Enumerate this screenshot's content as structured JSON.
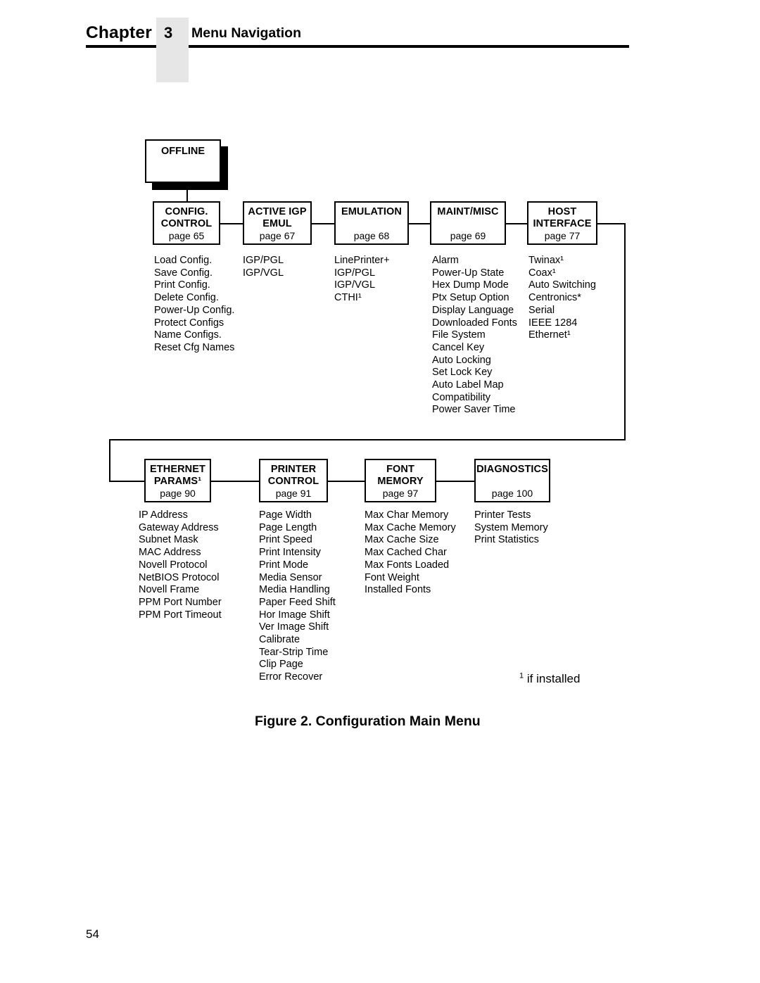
{
  "header": {
    "chapter_word": "Chapter",
    "chapter_number": "3",
    "chapter_title": "Menu Navigation"
  },
  "diagram": {
    "root": {
      "title": "OFFLINE"
    },
    "row1": [
      {
        "id": "config-control",
        "title_line1": "CONFIG.",
        "title_line2": "CONTROL",
        "page": "page 65",
        "items": [
          "Load Config.",
          "Save Config.",
          "Print Config.",
          "Delete Config.",
          "Power-Up Config.",
          "Protect Configs",
          "Name Configs.",
          "Reset Cfg Names"
        ]
      },
      {
        "id": "active-igp-emul",
        "title_line1": "ACTIVE IGP",
        "title_line2": "EMUL",
        "page": "page 67",
        "items": [
          "IGP/PGL",
          "IGP/VGL"
        ]
      },
      {
        "id": "emulation",
        "title_line1": "EMULATION",
        "title_line2": "",
        "page": "page 68",
        "items": [
          "LinePrinter+",
          "IGP/PGL",
          "IGP/VGL",
          "CTHI¹"
        ]
      },
      {
        "id": "maint-misc",
        "title_line1": "MAINT/MISC",
        "title_line2": "",
        "page": "page 69",
        "items": [
          "Alarm",
          "Power-Up State",
          "Hex Dump Mode",
          "Ptx Setup Option",
          "Display Language",
          "Downloaded Fonts",
          "File System",
          "Cancel Key",
          "Auto Locking",
          "Set Lock Key",
          "Auto Label Map",
          "Compatibility",
          "Power Saver Time"
        ]
      },
      {
        "id": "host-interface",
        "title_line1": "HOST",
        "title_line2": "INTERFACE",
        "page": "page 77",
        "items": [
          "Twinax¹",
          "Coax¹",
          "Auto Switching",
          "Centronics*",
          "Serial",
          "IEEE 1284",
          "Ethernet¹"
        ]
      }
    ],
    "row2": [
      {
        "id": "ethernet-params",
        "title_line1": "ETHERNET",
        "title_line2": "PARAMS¹",
        "page": "page 90",
        "items": [
          "IP Address",
          "Gateway Address",
          "Subnet Mask",
          "MAC Address",
          "Novell Protocol",
          "NetBIOS Protocol",
          "Novell Frame",
          "PPM Port Number",
          "PPM Port Timeout"
        ]
      },
      {
        "id": "printer-control",
        "title_line1": "PRINTER",
        "title_line2": "CONTROL",
        "page": "page 91",
        "items": [
          "Page Width",
          "Page Length",
          "Print Speed",
          "Print Intensity",
          "Print Mode",
          "Media Sensor",
          "Media Handling",
          "Paper Feed Shift",
          "Hor Image Shift",
          "Ver Image Shift",
          "Calibrate",
          "Tear-Strip Time",
          "Clip Page",
          "Error Recover"
        ]
      },
      {
        "id": "font-memory",
        "title_line1": "FONT",
        "title_line2": "MEMORY",
        "page": "page 97",
        "items": [
          "Max Char Memory",
          "Max Cache Memory",
          "Max Cache Size",
          "Max Cached Char",
          "Max Fonts Loaded",
          "Font Weight",
          "Installed Fonts"
        ]
      },
      {
        "id": "diagnostics",
        "title_line1": "DIAGNOSTICS",
        "title_line2": "",
        "page": "page 100",
        "items": [
          "Printer Tests",
          "System Memory",
          "Print Statistics"
        ]
      }
    ]
  },
  "footnote": "if installed",
  "footnote_marker": "1",
  "figure_caption": "Figure 2. Configuration Main Menu",
  "page_number": "54"
}
